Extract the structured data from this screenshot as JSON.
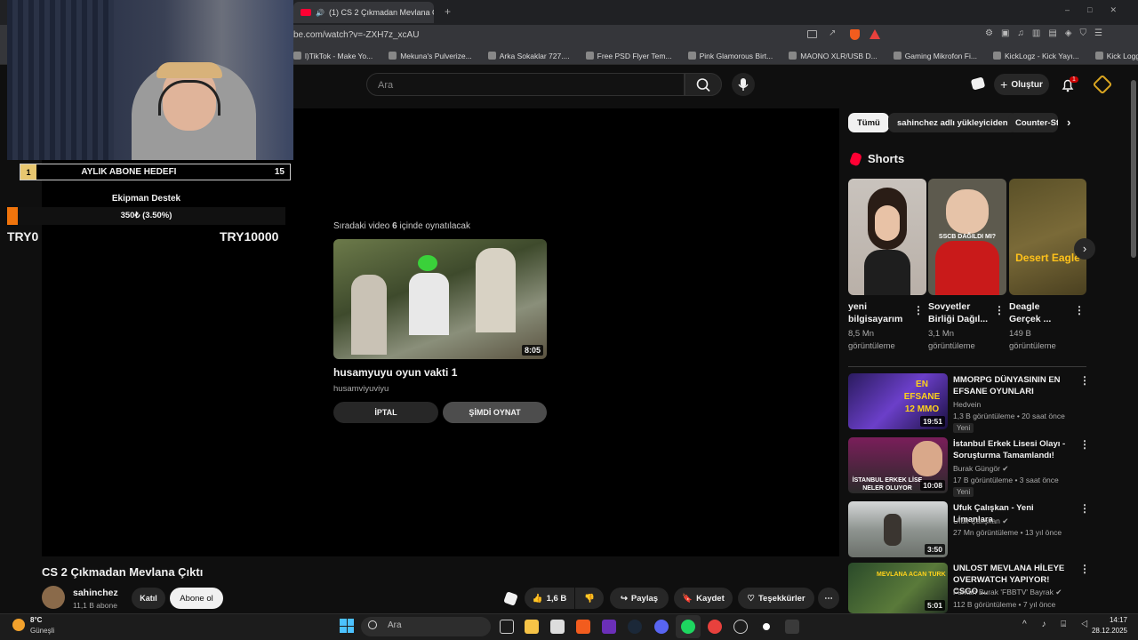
{
  "browser": {
    "tab_title": "(1) CS 2 Çıkmadan Mevlana Ç",
    "url": "be.com/watch?v=-ZXH7z_xcAU",
    "bookmarks": [
      "l)TikTok - Make Yo...",
      "Mekuna's Pulverize...",
      "Arka Sokaklar 727....",
      "Free PSD Flyer Tem...",
      "Pink Glamorous Birt...",
      "MAONO XLR/USB D...",
      "Gaming Mikrofon Fi...",
      "KickLogz - Kick Yayı...",
      "Kick Logger Dashbo..."
    ]
  },
  "header": {
    "search_placeholder": "Ara",
    "create_label": "Oluştur",
    "notif_count": "1"
  },
  "overlay": {
    "goal_index": "1",
    "goal_label": "AYLIK ABONE HEDEFI",
    "goal_count": "15",
    "donation_label": "Ekipman Destek",
    "donation_text": "350₺ (3.50%)",
    "donation_fraction": 0.035,
    "donation_min": "TRY0",
    "donation_max": "TRY10000"
  },
  "upnext": {
    "label_prefix": "Sıradaki video",
    "seconds": "6",
    "label_suffix": "içinde oynatılacak",
    "duration": "8:05",
    "title": "husamyuyu oyun vakti 1",
    "channel": "husamviyuviyu",
    "cancel_label": "İPTAL",
    "play_label": "ŞİMDİ OYNAT"
  },
  "video": {
    "title": "CS 2 Çıkmadan Mevlana Çıktı",
    "channel": "sahinchez",
    "subscribers": "11,1 B abone",
    "join_label": "Katıl",
    "subscribe_label": "Abone ol",
    "likes": "1,6 B",
    "share_label": "Paylaş",
    "save_label": "Kaydet",
    "thanks_label": "Teşekkürler"
  },
  "sidebar": {
    "chips": [
      "Tümü",
      "sahinchez adlı yükleyiciden",
      "Counter-St"
    ],
    "shorts_title": "Shorts",
    "shorts": [
      {
        "title1": "yeni",
        "title2": "bilgisayarım",
        "views1": "8,5 Mn",
        "views2": "görüntüleme",
        "thumb_text": ""
      },
      {
        "title1": "Sovyetler",
        "title2": "Birliği Dağıl...",
        "views1": "3,1 Mn",
        "views2": "görüntüleme",
        "thumb_text": "SSCB DAĞILDI MI?"
      },
      {
        "title1": "Deagle",
        "title2": "Gerçek ...",
        "views1": "149 B",
        "views2": "görüntüleme",
        "thumb_text": "Desert Eagle"
      }
    ],
    "recommendations": [
      {
        "title": "MMORPG DÜNYASININ EN EFSANE OYUNLARI",
        "channel": "Hedvein",
        "meta": "1,3 B görüntüleme • 20 saat önce",
        "badge": "Yeni",
        "duration": "19:51",
        "thumb_text": "EN EFSANE 12 MMO"
      },
      {
        "title": "İstanbul Erkek Lisesi Olayı - Soruşturma Tamamlandı!",
        "channel": "Burak Güngör",
        "meta": "17 B görüntüleme • 3 saat önce",
        "badge": "Yeni",
        "duration": "10:08",
        "thumb_text": "İSTANBUL ERKEK LİSE NELER OLUYOR"
      },
      {
        "title": "Ufuk Çalışkan - Yeni Limanlara",
        "channel": "Ufuk Çalışkan",
        "meta": "27 Mn görüntüleme • 13 yıl önce",
        "badge": "",
        "duration": "3:50",
        "thumb_text": ""
      },
      {
        "title": "UNLOST MEVLANA HİLEYE OVERWATCH YAPIYOR! CSGO ...",
        "channel": "Furkan Burak 'FBBTV' Bayrak",
        "meta": "112 B görüntüleme • 7 yıl önce",
        "badge": "",
        "duration": "5:01",
        "thumb_text": "MEVLANA ACAN TURK"
      }
    ]
  },
  "taskbar": {
    "temp": "8°C",
    "weather": "Güneşli",
    "search_placeholder": "Ara",
    "time": "14:17",
    "date": "28.12.2025"
  }
}
